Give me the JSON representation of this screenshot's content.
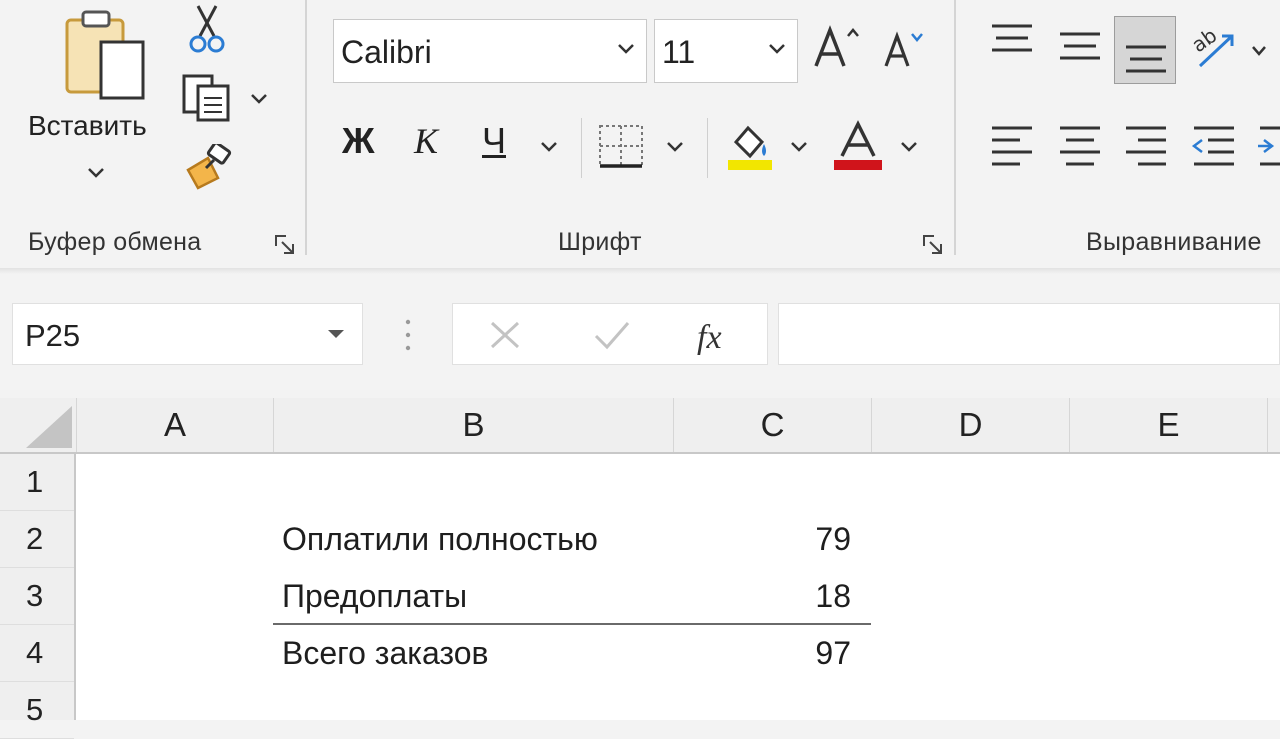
{
  "ribbon": {
    "clipboard": {
      "paste_label": "Вставить",
      "group_label": "Буфер обмена"
    },
    "font": {
      "font_name": "Calibri",
      "font_size": "11",
      "bold": "Ж",
      "italic": "К",
      "underline": "Ч",
      "group_label": "Шрифт",
      "fill_color": "#f2e600",
      "font_color": "#d0141b"
    },
    "alignment": {
      "group_label": "Выравнивание"
    }
  },
  "formula_bar": {
    "name_box": "P25",
    "formula": ""
  },
  "sheet": {
    "columns": [
      "A",
      "B",
      "C",
      "D",
      "E"
    ],
    "rows": [
      "1",
      "2",
      "3",
      "4",
      "5"
    ],
    "cells": {
      "B2": "Оплатили полностью",
      "C2": "79",
      "B3": "Предоплаты",
      "C3": "18",
      "B4": "Всего заказов",
      "C4": "97"
    }
  }
}
